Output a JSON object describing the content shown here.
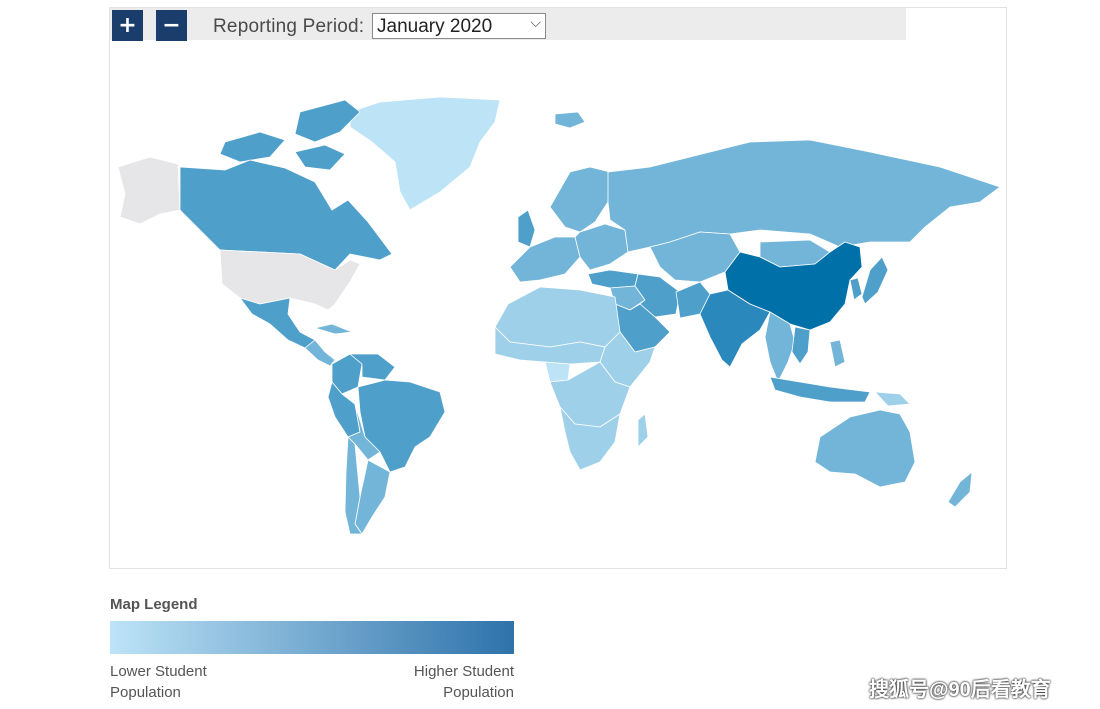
{
  "toolbar": {
    "zoom_in_label": "+",
    "zoom_out_label": "−",
    "period_label": "Reporting Period:",
    "period_value": "January 2020"
  },
  "map": {
    "no_data_color": "#e6e6e8",
    "color_scale": [
      "#bde3f7",
      "#9fd0ea",
      "#72b5d8",
      "#4f9fcb",
      "#2a88bc",
      "#0071a8"
    ],
    "regions": [
      {
        "name": "Greenland",
        "level": 0
      },
      {
        "name": "Canada",
        "level": 3
      },
      {
        "name": "United States",
        "level": null
      },
      {
        "name": "Alaska",
        "level": null
      },
      {
        "name": "Mexico",
        "level": 3
      },
      {
        "name": "Central America",
        "level": 2
      },
      {
        "name": "Cuba",
        "level": 2
      },
      {
        "name": "Colombia",
        "level": 3
      },
      {
        "name": "Venezuela",
        "level": 3
      },
      {
        "name": "Peru",
        "level": 3
      },
      {
        "name": "Brazil",
        "level": 3
      },
      {
        "name": "Bolivia",
        "level": 2
      },
      {
        "name": "Argentina",
        "level": 2
      },
      {
        "name": "Chile",
        "level": 2
      },
      {
        "name": "Iceland",
        "level": 2
      },
      {
        "name": "United Kingdom",
        "level": 3
      },
      {
        "name": "Scandinavia",
        "level": 2
      },
      {
        "name": "Western Europe",
        "level": 2
      },
      {
        "name": "Eastern Europe",
        "level": 2
      },
      {
        "name": "Russia",
        "level": 2
      },
      {
        "name": "Turkey",
        "level": 3
      },
      {
        "name": "Middle East",
        "level": 2
      },
      {
        "name": "Saudi Arabia",
        "level": 3
      },
      {
        "name": "Iran",
        "level": 3
      },
      {
        "name": "Central Asia",
        "level": 2
      },
      {
        "name": "Mongolia",
        "level": 2
      },
      {
        "name": "North Africa",
        "level": 1
      },
      {
        "name": "Sahel",
        "level": 1
      },
      {
        "name": "Nigeria",
        "level": 0
      },
      {
        "name": "Central Africa",
        "level": 1
      },
      {
        "name": "Horn of Africa",
        "level": 1
      },
      {
        "name": "Southern Africa",
        "level": 1
      },
      {
        "name": "Madagascar",
        "level": 1
      },
      {
        "name": "India",
        "level": 4
      },
      {
        "name": "Pakistan",
        "level": 3
      },
      {
        "name": "China",
        "level": 5
      },
      {
        "name": "Korea",
        "level": 3
      },
      {
        "name": "Japan",
        "level": 3
      },
      {
        "name": "Southeast Asia",
        "level": 2
      },
      {
        "name": "Vietnam",
        "level": 3
      },
      {
        "name": "Indonesia",
        "level": 3
      },
      {
        "name": "Philippines",
        "level": 2
      },
      {
        "name": "Papua New Guinea",
        "level": 1
      },
      {
        "name": "Australia",
        "level": 2
      },
      {
        "name": "New Zealand",
        "level": 2
      }
    ]
  },
  "legend": {
    "title": "Map Legend",
    "low_line1": "Lower Student",
    "low_line2": "Population",
    "high_line1": "Higher Student",
    "high_line2": "Population",
    "gradient_start": "#bde3f7",
    "gradient_end": "#2e72aa"
  },
  "watermark": "搜狐号@90后看教育"
}
